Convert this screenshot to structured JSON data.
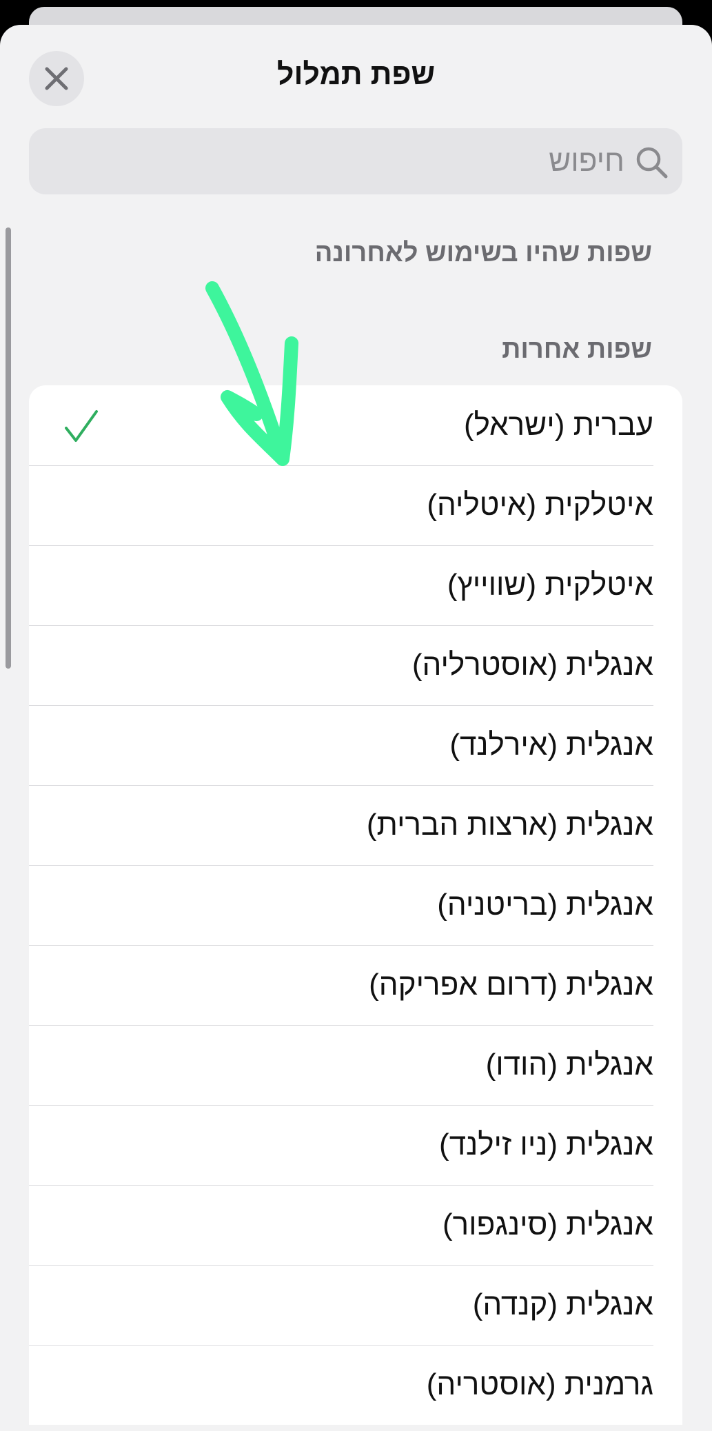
{
  "sheet": {
    "title": "שפת תמלול"
  },
  "search": {
    "placeholder": "חיפוש"
  },
  "sections": {
    "recent": "שפות שהיו בשימוש לאחרונה",
    "other": "שפות אחרות"
  },
  "languages": [
    {
      "label": "עברית (ישראל)",
      "selected": true
    },
    {
      "label": "איטלקית (איטליה)",
      "selected": false
    },
    {
      "label": "איטלקית (שווייץ)",
      "selected": false
    },
    {
      "label": "אנגלית (אוסטרליה)",
      "selected": false
    },
    {
      "label": "אנגלית (אירלנד)",
      "selected": false
    },
    {
      "label": "אנגלית (ארצות הברית)",
      "selected": false
    },
    {
      "label": "אנגלית (בריטניה)",
      "selected": false
    },
    {
      "label": "אנגלית (דרום אפריקה)",
      "selected": false
    },
    {
      "label": "אנגלית (הודו)",
      "selected": false
    },
    {
      "label": "אנגלית (ניו זילנד)",
      "selected": false
    },
    {
      "label": "אנגלית (סינגפור)",
      "selected": false
    },
    {
      "label": "אנגלית (קנדה)",
      "selected": false
    },
    {
      "label": "גרמנית (אוסטריה)",
      "selected": false
    }
  ],
  "colors": {
    "check": "#2fae5f",
    "annotation_arrow": "#3ef59c"
  },
  "icons": {
    "close": "close-icon",
    "search": "search-icon",
    "check": "check-icon",
    "annotation": "annotation-arrow"
  }
}
